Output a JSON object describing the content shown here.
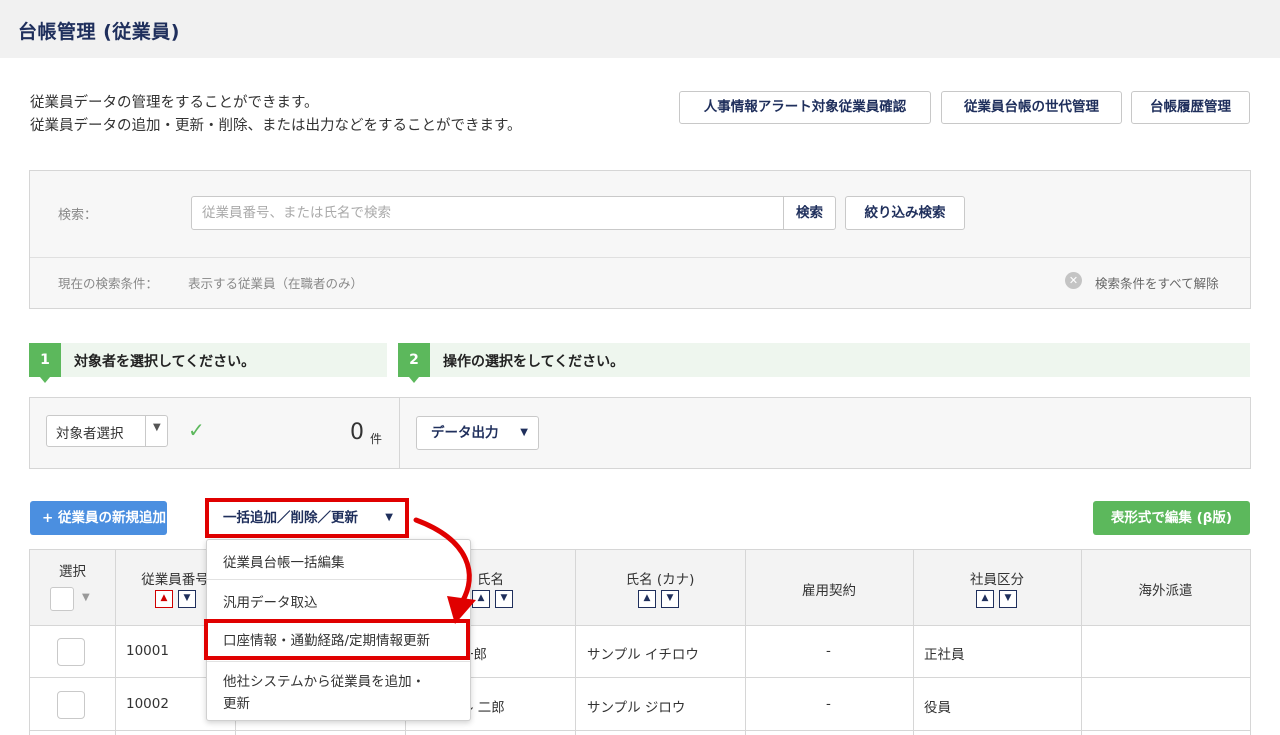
{
  "header": {
    "title": "台帳管理 (従業員)"
  },
  "description": {
    "line1": "従業員データの管理をすることができます。",
    "line2": "従業員データの追加・更新・削除、または出力などをすることができます。"
  },
  "top_buttons": {
    "alert": "人事情報アラート対象従業員確認",
    "generation": "従業員台帳の世代管理",
    "history": "台帳履歴管理"
  },
  "search": {
    "label": "検索：",
    "placeholder": "従業員番号、または氏名で検索",
    "search_button": "検索",
    "filter_button": "絞り込み検索",
    "condition_label": "現在の検索条件：",
    "condition_value": "表示する従業員（在職者のみ）",
    "clear_label": "検索条件をすべて解除"
  },
  "steps": [
    {
      "num": "1",
      "text": "対象者を選択してください。"
    },
    {
      "num": "2",
      "text": "操作の選択をしてください。"
    }
  ],
  "ops": {
    "target_select": "対象者選択",
    "count": "0",
    "count_unit": "件",
    "output_button": "データ出力"
  },
  "actions": {
    "add_employee": "+ 従業員の新規追加",
    "bulk": "一括追加／削除／更新",
    "grid_edit": "表形式で編集 (β版)"
  },
  "table": {
    "headers": {
      "select": "選択",
      "emp_no": "従業員番号",
      "name": "氏名",
      "name_kana": "氏名 (カナ)",
      "contract": "雇用契約",
      "category": "社員区分",
      "overseas": "海外派遣"
    },
    "rows": [
      {
        "emp_no": "10001",
        "name": "一郎",
        "name_kana": "サンプル イチロウ",
        "contract": "-",
        "category": "正社員"
      },
      {
        "emp_no": "10002",
        "name": "ル 二郎",
        "name_kana": "サンプル ジロウ",
        "contract": "-",
        "category": "役員"
      }
    ]
  },
  "bulk_menu": {
    "items": [
      "従業員台帳一括編集",
      "汎用データ取込",
      "口座情報・通勤経路/定期情報更新",
      "他社システムから従業員を追加・",
      "更新"
    ]
  },
  "colors": {
    "navy": "#1f2f5c",
    "green": "#5cb85c",
    "blue": "#4b8fe0",
    "highlight_red": "#e00000"
  }
}
